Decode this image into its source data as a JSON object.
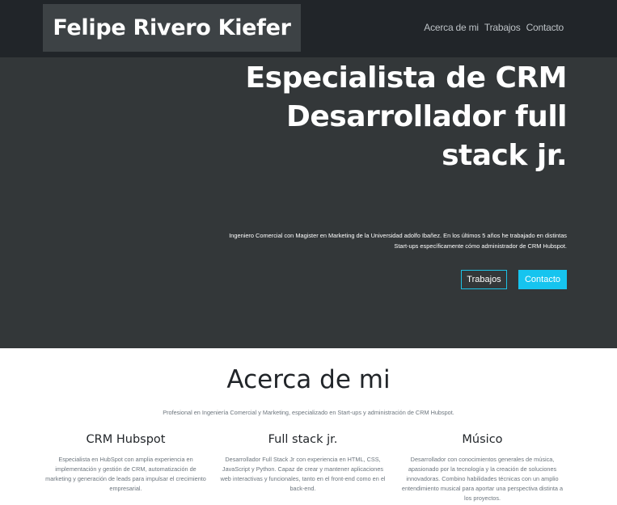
{
  "navbar": {
    "brand": "Felipe Rivero Kiefer",
    "links": [
      "Acerca de mi",
      "Trabajos",
      "Contacto"
    ]
  },
  "hero": {
    "title": "Especialista de CRM Desarrollador full stack jr.",
    "description": "Ingeniero Comercial con Magister en Marketing de la Universidad adolfo Ibañez. En los últimos 5 años he trabajado en distintas Start-ups específicamente cómo administrador de CRM Hubspot.",
    "buttons": {
      "trabajos": "Trabajos",
      "contacto": "Contacto"
    }
  },
  "about": {
    "title": "Acerca de mi",
    "subtitle": "Profesional en Ingeniería Comercial y Marketing, especializado en Start-ups y administración de CRM Hubspot.",
    "columns": [
      {
        "title": "CRM Hubspot",
        "text": "Especialista en HubSpot con amplia experiencia en implementación y gestión de CRM, automatización de marketing y generación de leads para impulsar el crecimiento empresarial."
      },
      {
        "title": "Full stack jr.",
        "text": "Desarrollador Full Stack Jr con experiencia en HTML, CSS, JavaScript y Python. Capaz de crear y mantener aplicaciones web interactivas y funcionales, tanto en el front-end como en el back-end."
      },
      {
        "title": "Músico",
        "text": "Desarrollador con conocimientos generales de música, apasionado por la tecnología y la creación de soluciones innovadoras. Combino habilidades técnicas con un amplio entendimiento musical para aportar una perspectiva distinta a los proyectos."
      }
    ]
  },
  "colors": {
    "navbar_bg": "#212529",
    "hero_bg": "#333739",
    "accent": "#16c4ef"
  }
}
